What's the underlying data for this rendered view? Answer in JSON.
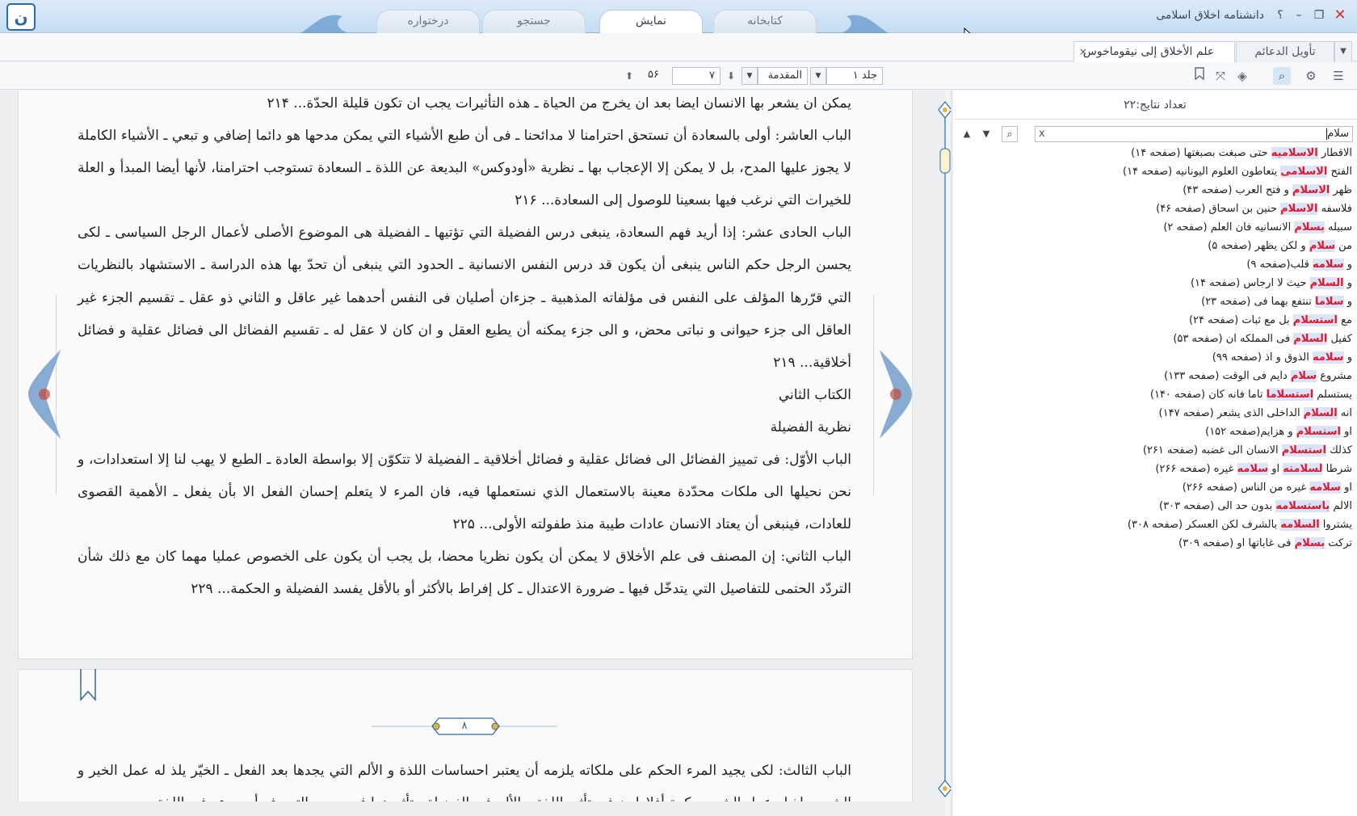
{
  "app": {
    "title": "دانشنامه اخلاق اسلامی",
    "logo_glyph": "ن",
    "help_label": "؟"
  },
  "window_controls": {
    "minimize": "–",
    "restore": "❐",
    "close": "✕"
  },
  "main_tabs": [
    {
      "label": "درختواره",
      "active": false
    },
    {
      "label": "جستجو",
      "active": false
    },
    {
      "label": "نمایش",
      "active": true
    },
    {
      "label": "کتابخانه",
      "active": false
    }
  ],
  "doc_tabs": [
    {
      "label": "علم الأخلاق إلى نيقوماخوس",
      "close": "×",
      "active": true
    },
    {
      "label": "تأویل الدعائم",
      "active": false
    }
  ],
  "doc_tabs_dropdown_icon": "chevron-down-icon",
  "toolbar": {
    "volume": "جلد ۱",
    "section": "المقدمة",
    "page": "۷",
    "total_pages": "۵۶",
    "icons": [
      "list-icon",
      "gear-icon",
      "search-icon",
      "layers-icon",
      "fullscreen-icon",
      "bookmark-icon"
    ]
  },
  "document": {
    "page1_paragraphs": [
      "يمكن ان يشعر بها الانسان ايضا بعد ان يخرج من الحياة ـ هذه التأثيرات يجب ان تكون قليلة الحدّة... ٢١۴",
      "الباب العاشر: أولى بالسعادة أن تستحق احترامنا لا مدائحنا ـ فى أن طبع الأشياء التي يمكن مدحها هو دائما إضافي و تبعي ـ الأشياء الكاملة لا يجوز عليها المدح، بل لا يمكن إلا الإعجاب بها ـ نظرية «أودوكس» البديعة عن اللذة ـ السعادة تستوجب احترامنا، لأنها أيضا المبدأ و العلة للخيرات التي نرغب فيها بسعينا للوصول إلى السعادة... ٢١۶",
      "الباب الحادى عشر: إذا أريد فهم السعادة، ينبغى درس الفضيلة التي تؤتيها ـ الفضيلة هى الموضوع الأصلى لأعمال الرجل السياسى ـ لكى يحسن الرجل حكم الناس ينبغى أن يكون قد درس النفس الانسانية ـ الحدود التي ينبغى أن تحدّ بها هذه الدراسة ـ الاستشهاد بالنظريات التي قرّرها المؤلف على النفس فى مؤلفاته المذهبية ـ جزءان أصليان فى النفس أحدهما غير عاقل و الثاني ذو عقل ـ تقسيم الجزء غير العاقل الى جزء حيوانى و نباتى محض، و الى جزء يمكنه أن يطيع العقل و ان كان لا عقل له ـ تقسيم الفضائل الى فضائل عقلية و فضائل أخلاقية... ٢١٩",
      "الكتاب الثاني",
      "نظرية الفضيلة",
      "الباب الأوّل: فى تمييز الفضائل الى فضائل عقلية و فضائل أخلاقية ـ الفضيلة لا تتكوّن إلا بواسطة العادة ـ الطبع لا يهب لنا إلا استعدادات، و نحن نحيلها الى ملكات محدّدة معينة بالاستعمال الذي نستعملها فيه، فان المرء لا يتعلم إحسان الفعل الا بأن يفعل ـ الأهمية القصوى للعادات، فينبغى أن يعتاد الانسان عادات طيبة منذ طفولته الأولى... ٢٢۵",
      "الباب الثاني: إن المصنف فى علم الأخلاق لا يمكن أن يكون نظريا محضا، بل يجب أن يكون على الخصوص عمليا مهما كان مع ذلك شأن التردّد الحتمى للتفاصيل التي يتدخّل فيها ـ ضرورة الاعتدال ـ كل إفراط بالأكثر أو بالأقل يفسد الفضيلة و الحكمة... ٢٢٩"
    ],
    "page2_number": "٨",
    "page2_paragraphs": [
      "الباب الثالث: لكى يجيد المرء الحكم على ملكاته يلزمه أن يعتبر احساسات اللذة و الألم التي يجدها بعد الفعل ـ الخيّر يلذ له عمل الخير و الشرير يلذ له عمل الشر ـ حكمة أفلاطون فى تأثير اللذة و الألم فى الفضيلة ـ تأثيرهما فى حسن التصرف أو سوءه فى اللذة و"
    ]
  },
  "search_panel": {
    "result_count": "تعداد نتایج:۲۲",
    "query": "سلام",
    "clear": "x",
    "results": [
      {
        "before": "الاقطار ",
        "hit": "الاسلاميه",
        "after": " حتى صبغت بصبغتها (صفحه ۱۴)"
      },
      {
        "before": "الفتح ",
        "hit": "الاسلامی",
        "after": " يتعاطون العلوم اليونانيه (صفحه ۱۴)"
      },
      {
        "before": "ظهر ",
        "hit": "الاسلام",
        "after": " و فتح العرب (صفحه ۴۳)"
      },
      {
        "before": "فلاسفه ",
        "hit": "الاسلام",
        "after": " حنين بن اسحاق (صفحه ۴۶)"
      },
      {
        "before": "سبيله ",
        "hit": "بسلام",
        "after": " الانسانيه فان العلم (صفحه ۲)"
      },
      {
        "before": "من ",
        "hit": "سلام",
        "after": " و لكن يظهر (صفحه ۵)"
      },
      {
        "before": "و ",
        "hit": "سلامه",
        "after": " قلب(صفحه ۹)"
      },
      {
        "before": "و ",
        "hit": "السلام",
        "after": " حيث لا ارجاس (صفحه ۱۴)"
      },
      {
        "before": "و ",
        "hit": "سلاما",
        "after": " تنتفع بهما فى (صفحه ۲۳)"
      },
      {
        "before": "مع ",
        "hit": "استسلام",
        "after": " بل مع ثبات (صفحه ۲۴)"
      },
      {
        "before": "كفيل ",
        "hit": "السلام",
        "after": " فى المملكه ان (صفحه ۵۳)"
      },
      {
        "before": "و ",
        "hit": "سلامه",
        "after": " الذوق و اذ (صفحه ۹۹)"
      },
      {
        "before": "مشروع ",
        "hit": "سلام",
        "after": " دايم فى الوقت (صفحه ۱۳۳)"
      },
      {
        "before": "يستسلم ",
        "hit": "استسلاما",
        "after": " تاما فانه كان (صفحه ۱۴۰)"
      },
      {
        "before": "انه ",
        "hit": "السلام",
        "after": " الداخلى الذى يشعر (صفحه ۱۴۷)"
      },
      {
        "before": "او ",
        "hit": "استسلام",
        "after": " و هزايم(صفحه ۱۵۲)"
      },
      {
        "before": "كذلك ",
        "hit": "استسلام",
        "after": " الانسان الى غضبه (صفحه ۲۶۱)"
      },
      {
        "before": "شرطا ",
        "hit": "لسلامته",
        "after": " او ",
        "hit2": "سلامه",
        "after2": " غيره (صفحه ۲۶۶)"
      },
      {
        "before": "او ",
        "hit": "سلامه",
        "after": " غيره من الناس (صفحه ۲۶۶)"
      },
      {
        "before": "الالم ",
        "hit": "باستسلامه",
        "after": " بدون حد الى (صفحه ۳۰۳)"
      },
      {
        "before": "يشتروا ",
        "hit": "السلامه",
        "after": " بالشرف لكن العسكر (صفحه ۳۰۸)"
      },
      {
        "before": "تركت ",
        "hit": "بسلام",
        "after": " فى غاباتها او (صفحه ۳۰۹)"
      }
    ]
  },
  "colors": {
    "accent": "#2e6aa8",
    "highlight_text": "#e0182a",
    "highlight_bg": "#dbe3f8"
  }
}
